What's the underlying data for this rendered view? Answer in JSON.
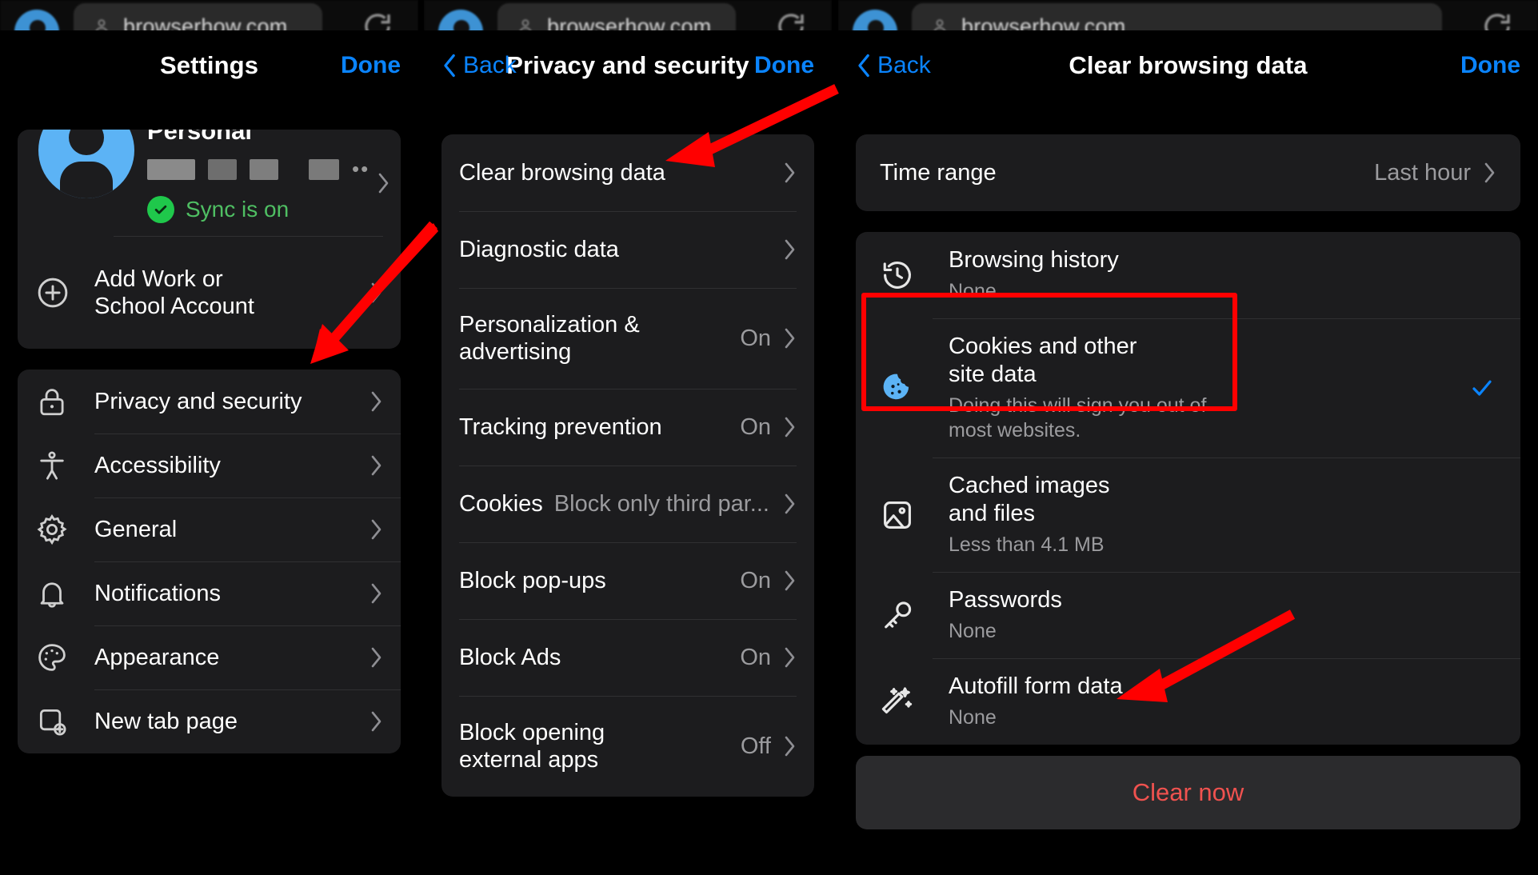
{
  "browser_chrome": {
    "url": "browserhow.com",
    "reload_icon": "reload-icon",
    "lock_icon": "site-info-icon",
    "avatar_icon": "profile-avatar-icon"
  },
  "panel_settings": {
    "nav": {
      "title": "Settings",
      "done_label": "Done"
    },
    "profile": {
      "name": "Personal",
      "redacted_email": "••",
      "sync_status": "Sync is on",
      "chevron_icon": "chevron-right-icon",
      "avatar_icon": "account-avatar-icon",
      "sync_check_icon": "check-circle-icon"
    },
    "add_account": {
      "label": "Add Work or\nSchool Account",
      "icon": "plus-circle-icon",
      "chevron_icon": "chevron-right-icon"
    },
    "items": [
      {
        "label": "Privacy and security",
        "icon": "lock-icon",
        "chevron_icon": "chevron-right-icon"
      },
      {
        "label": "Accessibility",
        "icon": "accessibility-icon",
        "chevron_icon": "chevron-right-icon"
      },
      {
        "label": "General",
        "icon": "gear-icon",
        "chevron_icon": "chevron-right-icon"
      },
      {
        "label": "Notifications",
        "icon": "bell-icon",
        "chevron_icon": "chevron-right-icon"
      },
      {
        "label": "Appearance",
        "icon": "palette-icon",
        "chevron_icon": "chevron-right-icon"
      },
      {
        "label": "New tab page",
        "icon": "new-tab-icon",
        "chevron_icon": "chevron-right-icon"
      }
    ]
  },
  "panel_privacy": {
    "nav": {
      "back_label": "Back",
      "title": "Privacy and security",
      "done_label": "Done",
      "back_icon": "chevron-left-icon"
    },
    "items": [
      {
        "label": "Clear browsing data",
        "value": "",
        "chevron_icon": "chevron-right-icon"
      },
      {
        "label": "Diagnostic data",
        "value": "",
        "chevron_icon": "chevron-right-icon"
      },
      {
        "label": "Personalization &\nadvertising",
        "value": "On",
        "chevron_icon": "chevron-right-icon"
      },
      {
        "label": "Tracking prevention",
        "value": "On",
        "chevron_icon": "chevron-right-icon"
      },
      {
        "label": "Cookies",
        "value": "Block only third par...",
        "chevron_icon": "chevron-right-icon"
      },
      {
        "label": "Block pop-ups",
        "value": "On",
        "chevron_icon": "chevron-right-icon"
      },
      {
        "label": "Block Ads",
        "value": "On",
        "chevron_icon": "chevron-right-icon"
      },
      {
        "label": "Block opening\nexternal apps",
        "value": "Off",
        "chevron_icon": "chevron-right-icon"
      }
    ]
  },
  "panel_clear": {
    "nav": {
      "back_label": "Back",
      "title": "Clear browsing data",
      "done_label": "Done",
      "back_icon": "chevron-left-icon"
    },
    "time_range": {
      "label": "Time range",
      "value": "Last hour",
      "chevron_icon": "chevron-right-icon"
    },
    "items": [
      {
        "label": "Browsing history",
        "sub": "None",
        "icon": "history-icon",
        "checked": false
      },
      {
        "label": "Cookies and other\nsite data",
        "sub": "Doing this will sign you out of\nmost websites.",
        "icon": "cookie-icon",
        "checked": true,
        "check_icon": "checkmark-icon"
      },
      {
        "label": "Cached images\nand files",
        "sub": "Less than 4.1 MB",
        "icon": "image-icon",
        "checked": false
      },
      {
        "label": "Passwords",
        "sub": "None",
        "icon": "key-icon",
        "checked": false
      },
      {
        "label": "Autofill form data",
        "sub": "None",
        "icon": "magic-wand-icon",
        "checked": false
      }
    ],
    "clear_now_label": "Clear now"
  },
  "annotations": {
    "highlight_color": "#ff0000",
    "arrows": [
      {
        "name": "arrow-to-privacy-and-security"
      },
      {
        "name": "arrow-to-clear-browsing-data"
      },
      {
        "name": "arrow-to-clear-now"
      }
    ],
    "highlight_box": {
      "name": "cookies-and-site-data-highlight"
    }
  }
}
